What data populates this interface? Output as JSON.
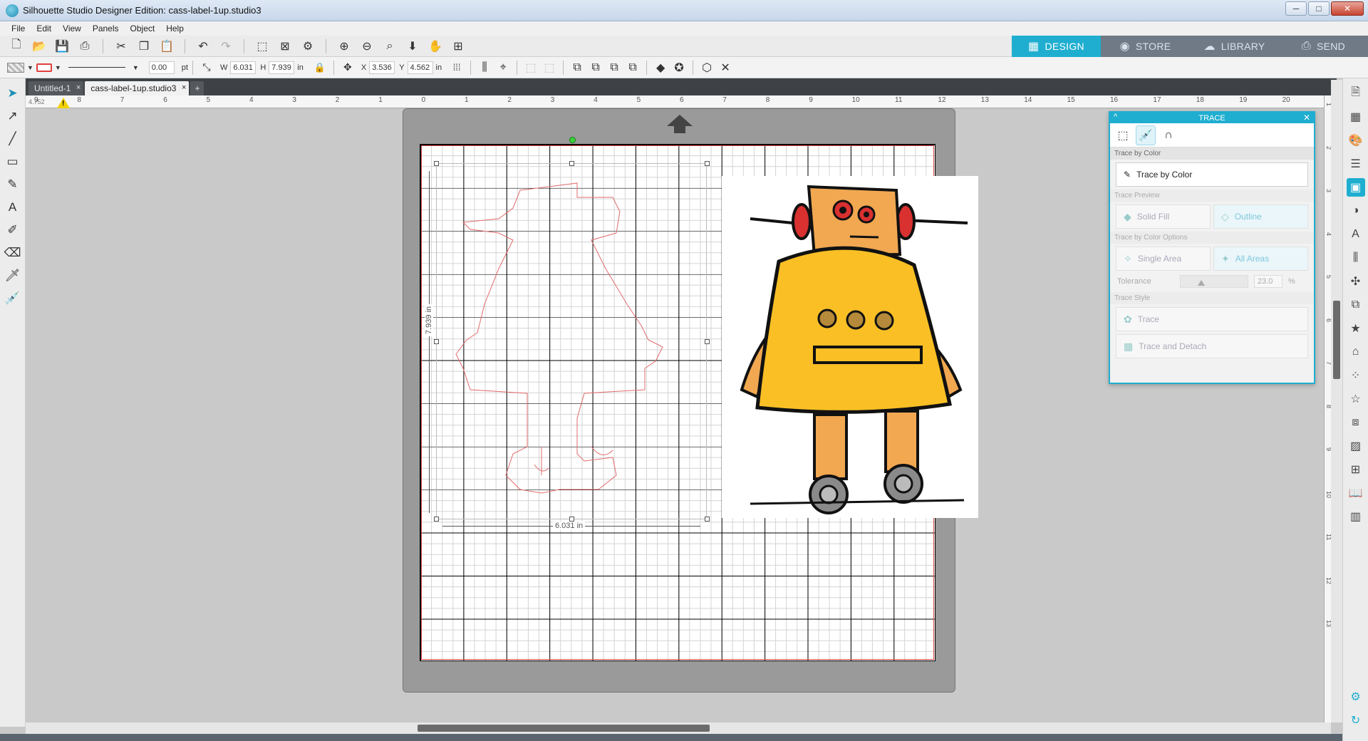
{
  "window": {
    "title": "Silhouette Studio Designer Edition: cass-label-1up.studio3",
    "minimize": "─",
    "maximize": "□",
    "close": "✕"
  },
  "menu": [
    "File",
    "Edit",
    "View",
    "Panels",
    "Object",
    "Help"
  ],
  "nav_tabs": [
    {
      "label": "DESIGN",
      "glyph": "▦"
    },
    {
      "label": "STORE",
      "glyph": "◉"
    },
    {
      "label": "LIBRARY",
      "glyph": "☁"
    },
    {
      "label": "SEND",
      "glyph": "⎙"
    }
  ],
  "shape_toolbar": {
    "line_width": "0.00",
    "line_unit": "pt",
    "w_label": "W",
    "w_value": "6.031",
    "h_label": "H",
    "h_value": "7.939",
    "size_unit": "in",
    "x_label": "X",
    "x_value": "3.536",
    "y_label": "Y",
    "y_value": "4.562",
    "pos_unit": "in"
  },
  "doc_tabs": [
    {
      "label": "Untitled-1",
      "close": "×"
    },
    {
      "label": "cass-label-1up.studio3",
      "close": "×"
    }
  ],
  "add_tab": "+",
  "ruler": {
    "readout": "4.752",
    "top_numbers": [
      "9",
      "8",
      "7",
      "6",
      "5",
      "4",
      "3",
      "2",
      "1",
      "0",
      "1",
      "2",
      "3",
      "4",
      "5",
      "6",
      "7",
      "8",
      "9",
      "10",
      "11",
      "12",
      "13",
      "14",
      "15",
      "16",
      "17",
      "18",
      "19",
      "20"
    ],
    "right_numbers": [
      "1",
      "2",
      "3",
      "4",
      "5",
      "6",
      "7",
      "8",
      "9",
      "10",
      "11",
      "12",
      "13"
    ]
  },
  "warning": "!",
  "dimensions": {
    "width_label": "6.031 in",
    "height_label": "7.939 in"
  },
  "trace_panel": {
    "title": "TRACE",
    "collapse": "^",
    "close": "✕",
    "section_trace_by_color": "Trace by Color",
    "btn_trace_by_color": "Trace by Color",
    "section_preview": "Trace Preview",
    "btn_solid_fill": "Solid Fill",
    "btn_outline": "Outline",
    "section_options": "Trace by Color Options",
    "btn_single_area": "Single Area",
    "btn_all_areas": "All Areas",
    "tolerance_label": "Tolerance",
    "tolerance_value": "23.0",
    "tolerance_unit": "%",
    "section_style": "Trace Style",
    "btn_trace": "Trace",
    "btn_trace_detach": "Trace and Detach"
  },
  "colors": {
    "accent": "#1faed0",
    "cut_line": "#e24a4a",
    "robot_body": "#f9bf25",
    "robot_head": "#f1a851",
    "robot_red": "#d93030"
  }
}
